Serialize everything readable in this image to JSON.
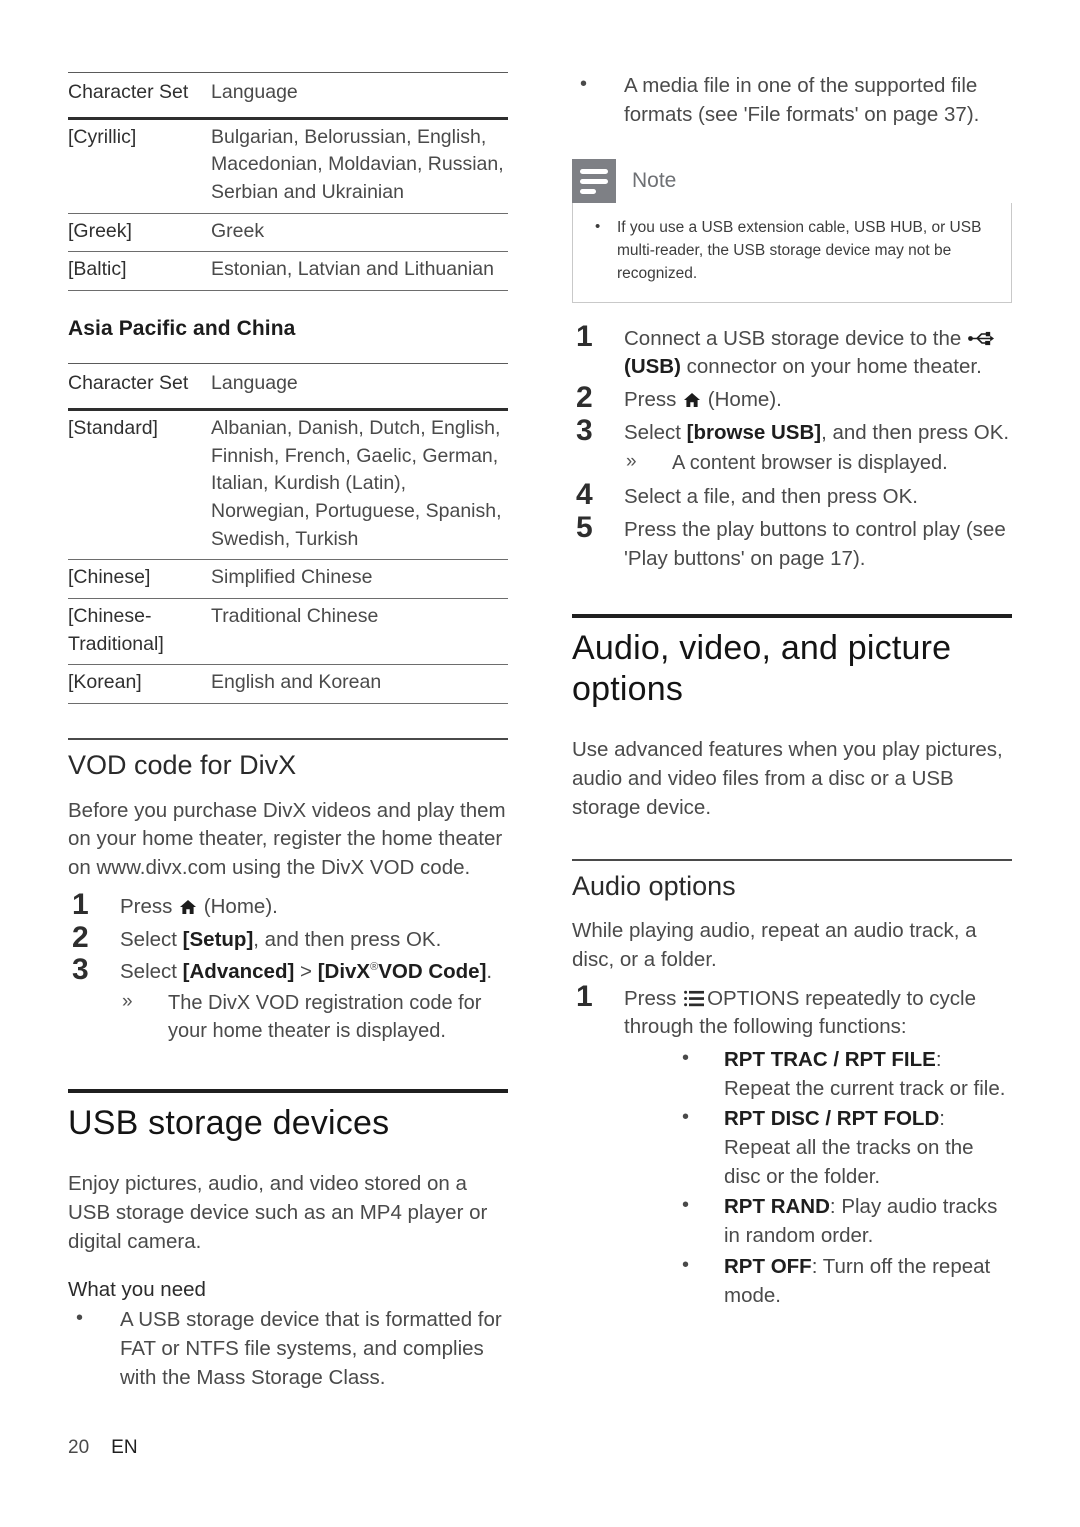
{
  "page": {
    "number": "20",
    "language_code": "EN"
  },
  "left_column": {
    "table_europe": {
      "headers": [
        "Character Set",
        "Language"
      ],
      "rows": [
        {
          "set": "[Cyrillic]",
          "language": "Bulgarian, Belorussian, English, Macedonian, Moldavian, Russian, Serbian and Ukrainian"
        },
        {
          "set": "[Greek]",
          "language": "Greek"
        },
        {
          "set": "[Baltic]",
          "language": "Estonian, Latvian and Lithuanian"
        }
      ]
    },
    "region_heading": "Asia Pacific and China",
    "table_asia": {
      "headers": [
        "Character Set",
        "Language"
      ],
      "rows": [
        {
          "set": "[Standard]",
          "language": "Albanian, Danish, Dutch, English, Finnish, French, Gaelic, German, Italian, Kurdish (Latin), Norwegian, Portuguese, Spanish, Swedish, Turkish"
        },
        {
          "set": "[Chinese]",
          "language": "Simplified Chinese"
        },
        {
          "set": "[Chinese-Traditional]",
          "language": "Traditional Chinese"
        },
        {
          "set": "[Korean]",
          "language": "English and Korean"
        }
      ]
    },
    "vod_section": {
      "heading": "VOD code for DivX",
      "intro": "Before you purchase DivX videos and play them on your home theater, register the home theater on www.divx.com using the DivX VOD code.",
      "steps": [
        {
          "prefix": "Press ",
          "icon": "home-icon",
          "suffix": " (Home)."
        },
        {
          "text_before": "Select ",
          "bold": "[Setup]",
          "text_after": ", and then press OK."
        },
        {
          "text_before": "Select ",
          "bold1": "[Advanced]",
          "mid": " > ",
          "bold2": "[DivX",
          "reg": "®",
          "bold3": "VOD Code]",
          "text_after": "."
        }
      ],
      "result": "The DivX VOD registration code for your home theater is displayed."
    },
    "usb_section": {
      "heading": "USB storage devices",
      "intro": "Enjoy pictures, audio, and video stored on a USB storage device such as an MP4 player or digital camera.",
      "what_you_need": "What you need",
      "requirement": "A USB storage device that is formatted for FAT or NTFS file systems, and complies with the Mass Storage Class."
    }
  },
  "right_column": {
    "top_bullet": "A media file in one of the supported file formats (see 'File formats' on page 37).",
    "note": {
      "title": "Note",
      "icon": "note-lines-icon",
      "items": [
        "If you use a USB extension cable, USB HUB, or USB multi-reader, the USB storage device may not be recognized."
      ]
    },
    "usb_steps": {
      "step1_before": "Connect a USB storage device to the ",
      "step1_icon": "usb-icon",
      "step1_after_bold": "(USB)",
      "step1_after": " connector on your home theater.",
      "step2_before": "Press ",
      "step2_icon": "home-icon",
      "step2_after": " (Home).",
      "step3_before": "Select ",
      "step3_bold": "[browse USB]",
      "step3_after": ", and then press OK.",
      "step3_result": "A content browser is displayed.",
      "step4": "Select a file, and then press OK.",
      "step5": "Press the play buttons to control play (see 'Play buttons' on page 17)."
    },
    "avp_section": {
      "heading": "Audio, video, and picture options",
      "intro": "Use advanced features when you play pictures, audio and video files from a disc or a USB storage device."
    },
    "audio_options": {
      "heading": "Audio options",
      "intro": "While playing audio, repeat an audio track, a disc, or a folder.",
      "step1_before": "Press ",
      "step1_icon": "options-icon",
      "step1_after": "OPTIONS repeatedly to cycle through the following functions:",
      "functions": [
        {
          "term": "RPT TRAC / RPT FILE",
          "desc": ": Repeat the current track or file."
        },
        {
          "term": "RPT DISC / RPT FOLD",
          "desc": ": Repeat all the tracks on the disc or the folder."
        },
        {
          "term": "RPT RAND",
          "desc": ": Play audio tracks in random order."
        },
        {
          "term": "RPT OFF",
          "desc": ": Turn off the repeat mode."
        }
      ]
    }
  },
  "colors": {
    "rule_heavy": "#1f1f1f",
    "rule_medium": "#4a4a4a",
    "rule_light": "#6d6d6d",
    "note_icon_bg": "#7e8085",
    "body_text": "#4a4a4a"
  }
}
